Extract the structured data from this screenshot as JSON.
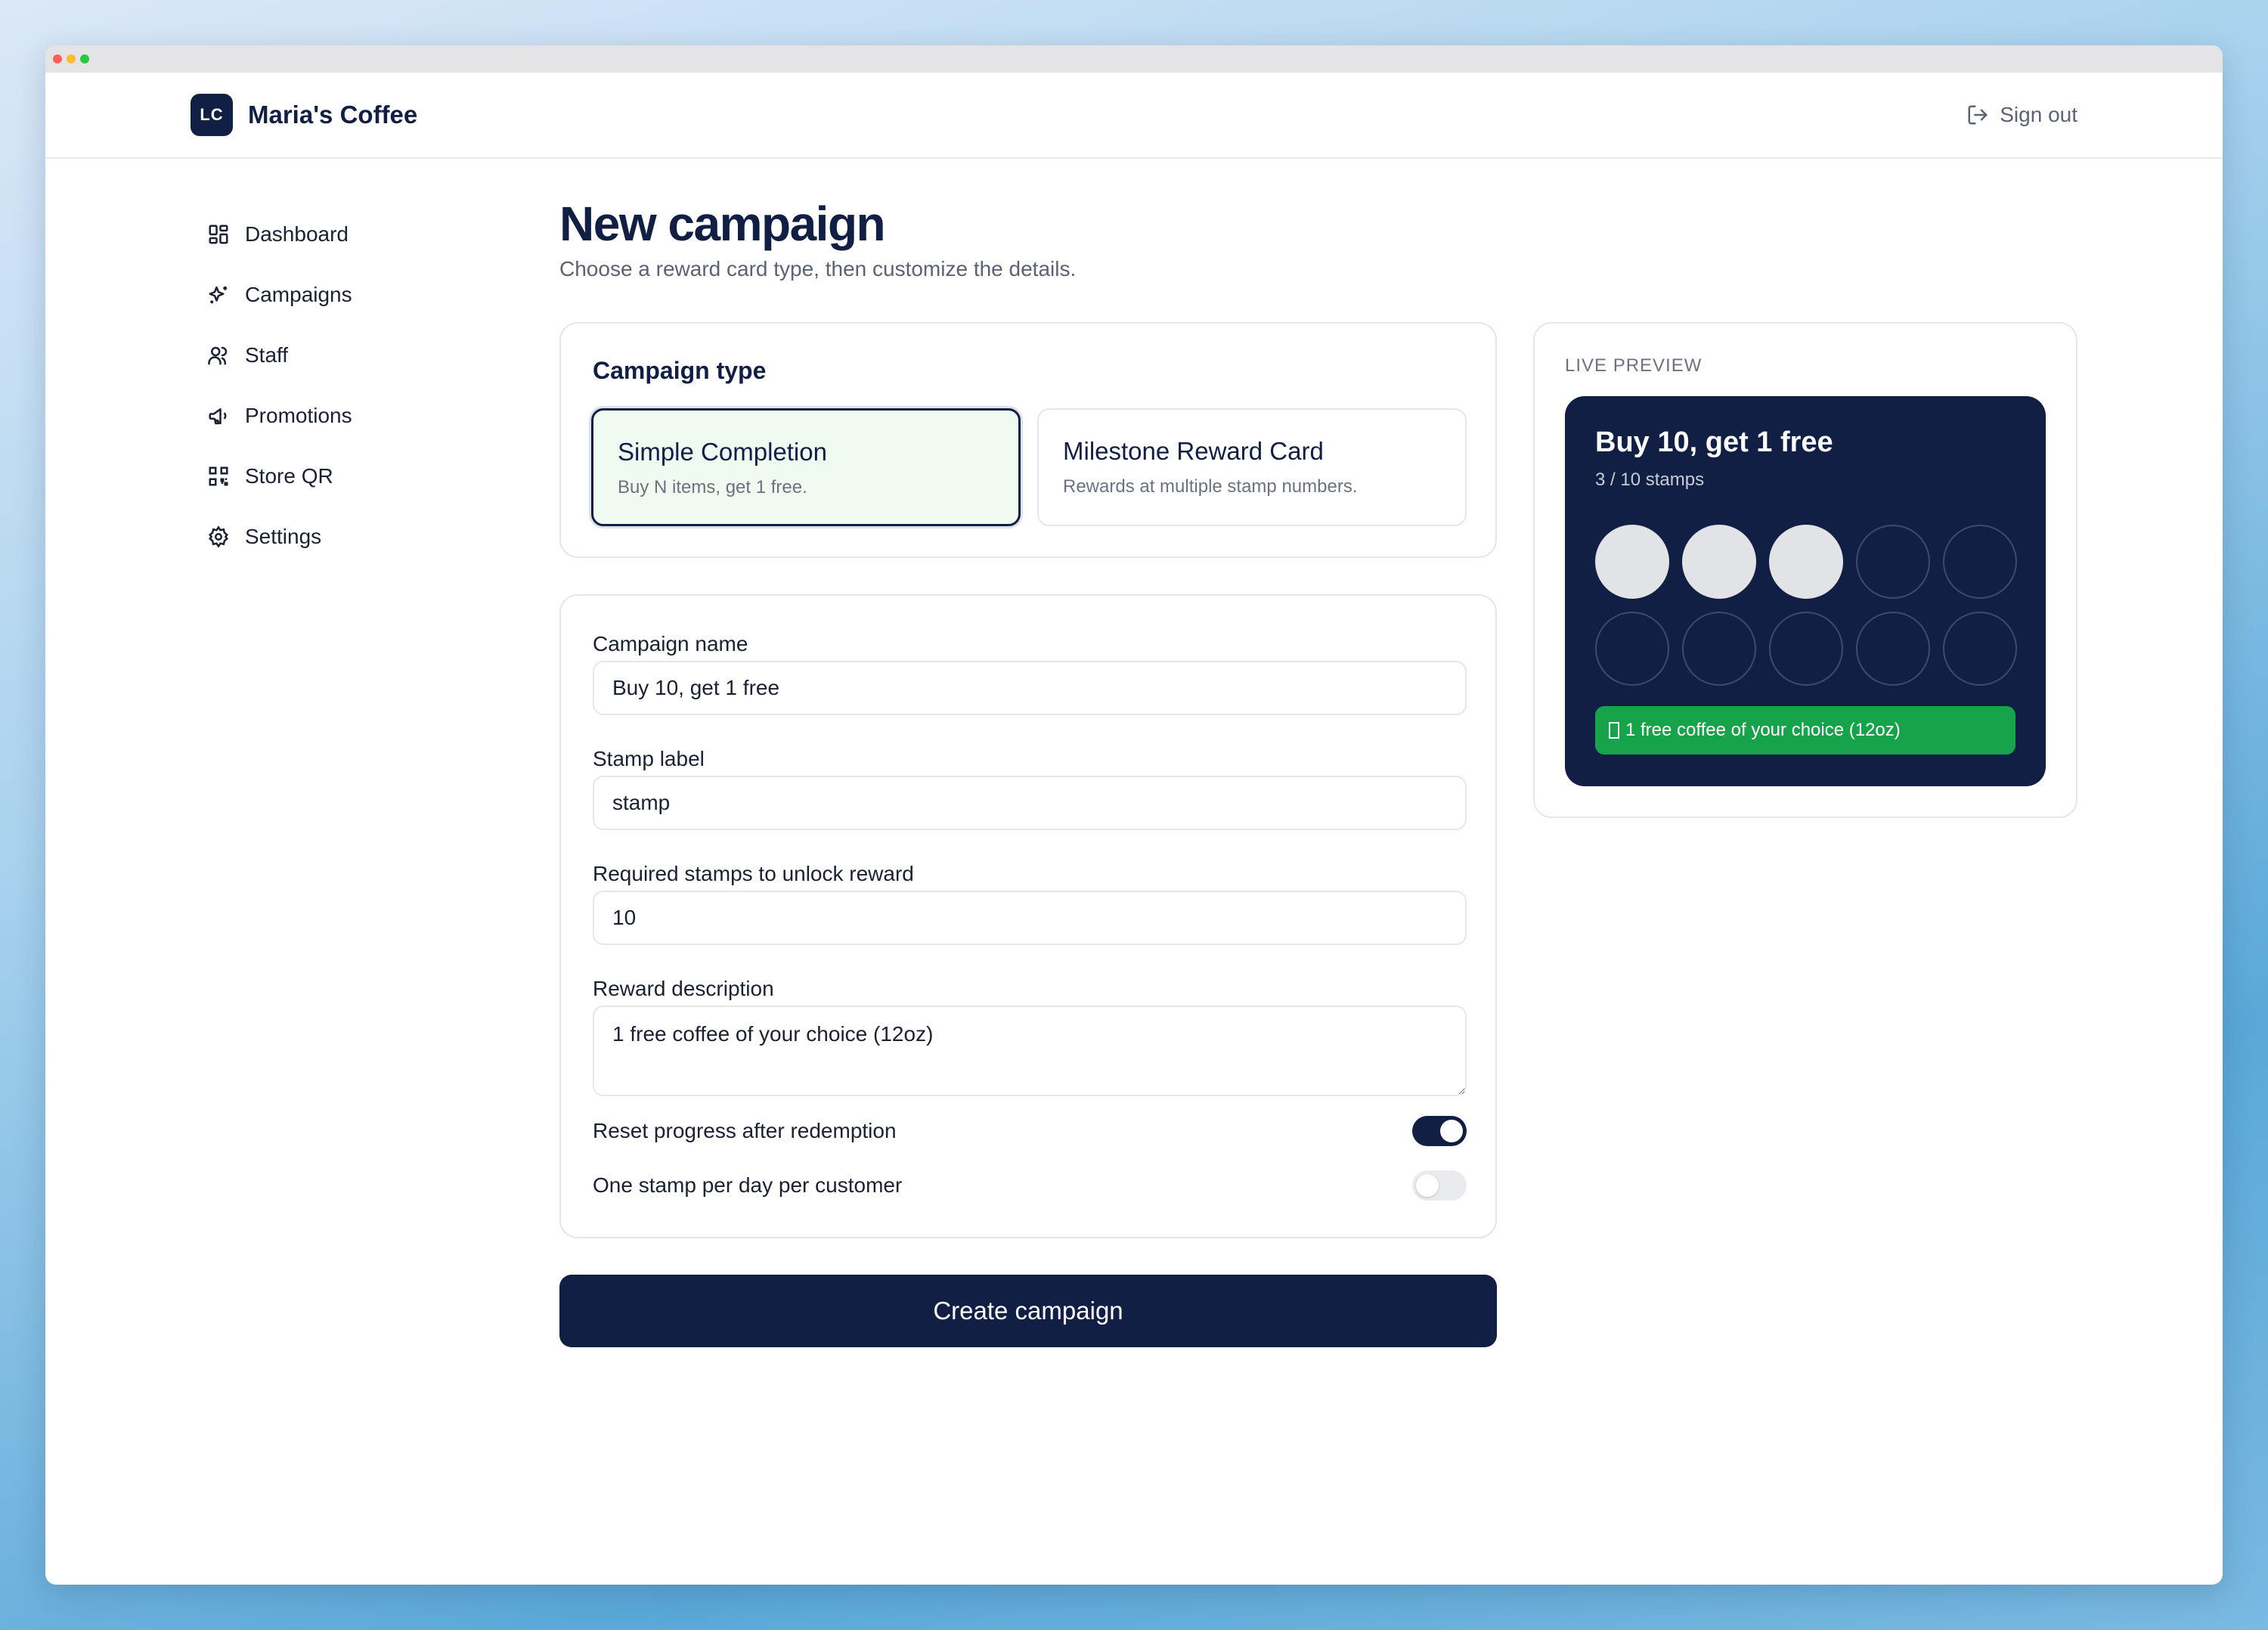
{
  "app": {
    "brand_initials": "LC",
    "brand_name": "Maria's Coffee",
    "signout_label": "Sign out"
  },
  "sidebar": {
    "items": [
      {
        "label": "Dashboard",
        "icon": "dashboard-icon"
      },
      {
        "label": "Campaigns",
        "icon": "sparkle-icon"
      },
      {
        "label": "Staff",
        "icon": "users-icon"
      },
      {
        "label": "Promotions",
        "icon": "megaphone-icon"
      },
      {
        "label": "Store QR",
        "icon": "qr-code-icon"
      },
      {
        "label": "Settings",
        "icon": "gear-icon"
      }
    ]
  },
  "page": {
    "title": "New campaign",
    "subtitle": "Choose a reward card type, then customize the details."
  },
  "campaign_type": {
    "heading": "Campaign type",
    "options": [
      {
        "title": "Simple Completion",
        "description": "Buy N items, get 1 free.",
        "selected": true
      },
      {
        "title": "Milestone Reward Card",
        "description": "Rewards at multiple stamp numbers.",
        "selected": false
      }
    ]
  },
  "form": {
    "campaign_name_label": "Campaign name",
    "campaign_name_value": "Buy 10, get 1 free",
    "stamp_label_label": "Stamp label",
    "stamp_label_value": "stamp",
    "required_stamps_label": "Required stamps to unlock reward",
    "required_stamps_value": "10",
    "reward_description_label": "Reward description",
    "reward_description_value": "1 free coffee of your choice (12oz)",
    "toggles": [
      {
        "label": "Reset progress after redemption",
        "on": true
      },
      {
        "label": "One stamp per day per customer",
        "on": false
      }
    ]
  },
  "actions": {
    "create_label": "Create campaign"
  },
  "preview": {
    "section_label": "LIVE PREVIEW",
    "card_title": "Buy 10, get 1 free",
    "progress_text": "3 / 10 stamps",
    "stamps_filled": 3,
    "stamps_total": 10,
    "reward_text": "1 free coffee of your choice (12oz)",
    "reward_icon": "gift-icon"
  },
  "colors": {
    "brand_navy": "#121f45",
    "reward_green": "#16a34a",
    "selected_bg": "#effaf1"
  }
}
